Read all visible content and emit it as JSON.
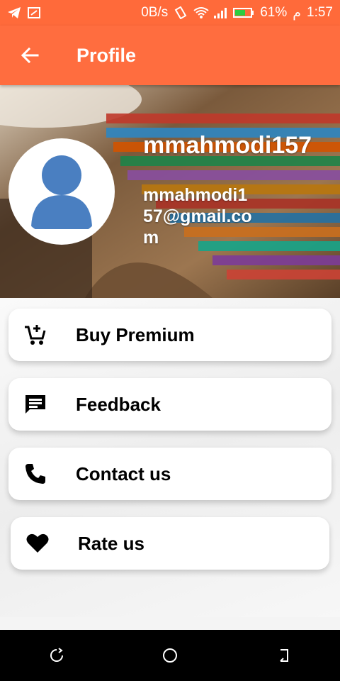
{
  "status_bar": {
    "speed": "0B/s",
    "battery": "61%",
    "time_suffix": "م",
    "time": "1:57",
    "icons": [
      "telegram-icon",
      "screen-icon",
      "vibrate-icon",
      "wifi-icon",
      "signal-icon",
      "battery-icon"
    ]
  },
  "app_bar": {
    "title": "Profile",
    "back_icon": "arrow-left-icon"
  },
  "profile": {
    "username": "mmahmodi157",
    "email": "mmahmodi157@gmail.com"
  },
  "menu": [
    {
      "label": "Buy Premium",
      "icon": "cart-plus-icon"
    },
    {
      "label": "Feedback",
      "icon": "message-icon"
    },
    {
      "label": "Contact us",
      "icon": "phone-icon"
    },
    {
      "label": "Rate us",
      "icon": "heart-icon"
    }
  ],
  "nav_bar": {
    "icons": [
      "recent-apps-icon",
      "home-icon",
      "back-icon"
    ]
  },
  "colors": {
    "accent": "#ff6d3f",
    "avatar": "#4a7fc1"
  }
}
